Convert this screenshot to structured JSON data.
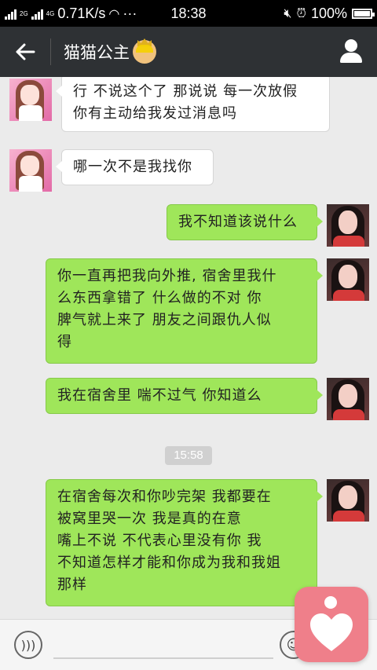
{
  "status_bar": {
    "net_2g": "2G",
    "net_4g": "4G",
    "speed": "0.71K/s",
    "more": "···",
    "time": "18:38",
    "battery": "100%"
  },
  "titlebar": {
    "back_icon": "arrow-left-icon",
    "title": "猫猫公主",
    "emoji": "princess-emoji-icon",
    "profile_icon": "person-icon"
  },
  "messages": [
    {
      "side": "left",
      "lines": [
        "行 不说这个了 那说说 每一次放假",
        "你有主动给我发过消息吗"
      ]
    },
    {
      "side": "left",
      "lines": [
        "哪一次不是我找你"
      ]
    },
    {
      "side": "right",
      "lines": [
        "我不知道该说什么"
      ]
    },
    {
      "side": "right",
      "lines": [
        "你一直再把我向外推, 宿舍里我什",
        "么东西拿错了  什么做的不对  你",
        "脾气就上来了  朋友之间跟仇人似",
        "得"
      ]
    },
    {
      "side": "right",
      "lines": [
        "我在宿舍里  喘不过气  你知道么"
      ]
    },
    {
      "side": "right",
      "lines": [
        "在宿舍每次和你吵完架  我都要在",
        "被窝里哭一次   我是真的在意",
        "嘴上不说 不代表心里没有你   我",
        "不知道怎样才能和你成为我和我姐",
        "那样"
      ]
    }
  ],
  "timestamp": "15:58",
  "input_bar": {
    "voice_icon": "voice-icon",
    "emoji_icon": "smiley-icon"
  },
  "floating_button": {
    "icon": "heart-person-icon"
  },
  "colors": {
    "status_bg": "#000000",
    "title_bg": "#2e3134",
    "chat_bg": "#ebebeb",
    "bubble_right": "#9fe65a",
    "bubble_left": "#ffffff",
    "float_btn": "#ef7f8a"
  }
}
